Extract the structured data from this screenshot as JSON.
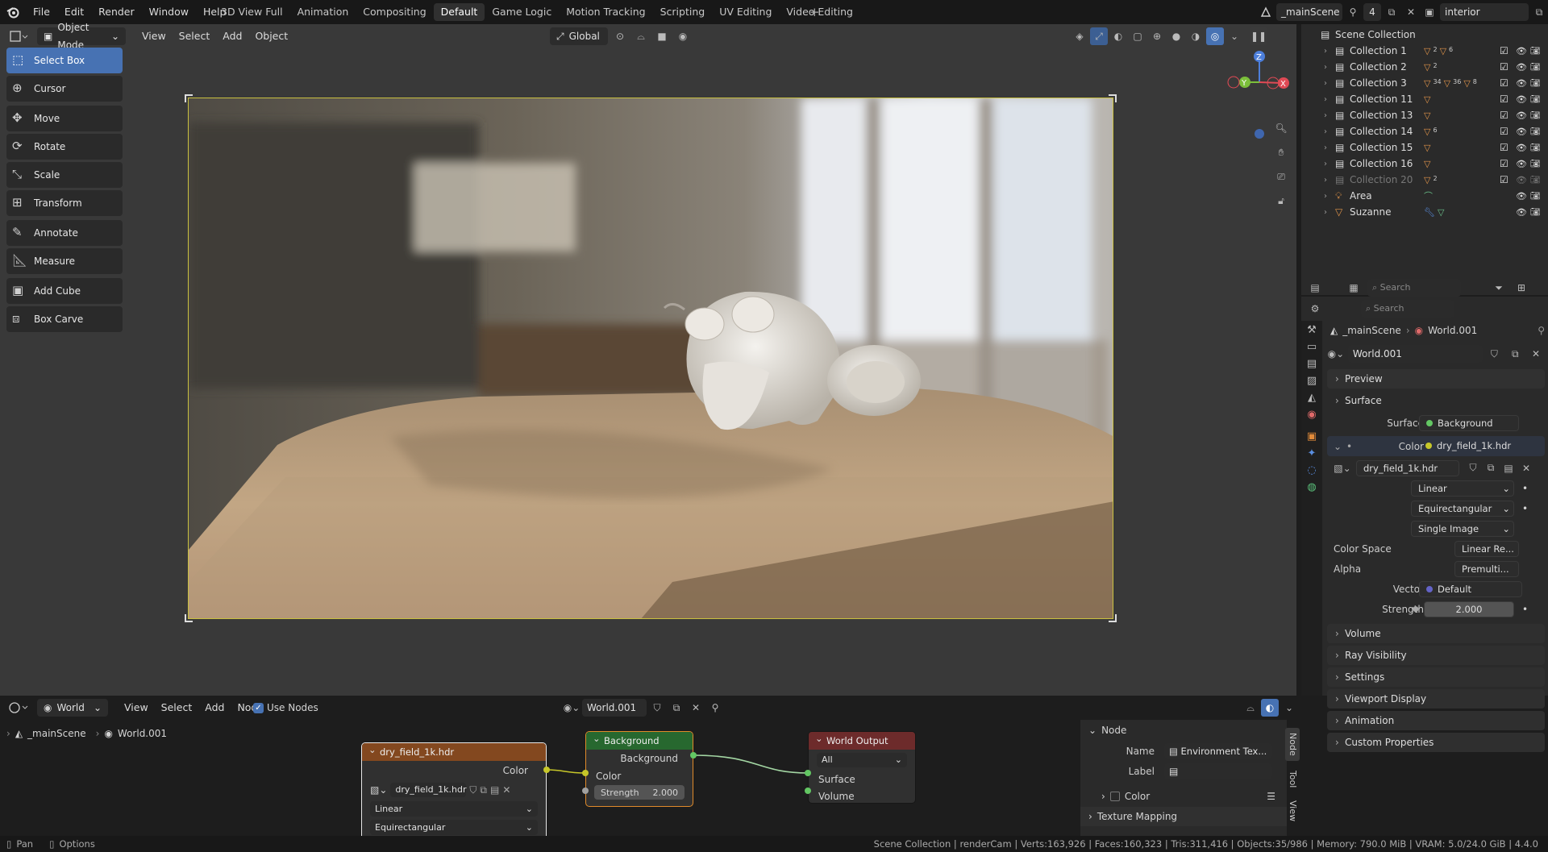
{
  "topbar": {
    "menus": [
      "File",
      "Edit",
      "Render",
      "Window",
      "Help"
    ],
    "workspaces": [
      "3D View Full",
      "Animation",
      "Compositing",
      "Default",
      "Game Logic",
      "Motion Tracking",
      "Scripting",
      "UV Editing",
      "Video Editing"
    ],
    "active_workspace": "Default",
    "scene_name": "_mainScene",
    "scene_users": "4",
    "view_layer": "interior"
  },
  "viewport": {
    "mode": "Object Mode",
    "menus": [
      "View",
      "Select",
      "Add",
      "Object"
    ],
    "transform_orientation": "Global",
    "axes": {
      "z": "Z",
      "y": "Y",
      "x": "X"
    }
  },
  "toolbar": {
    "tools": [
      {
        "label": "Select Box",
        "icon": "select-box-icon",
        "active": true
      },
      {
        "label": "Cursor",
        "icon": "cursor-icon"
      },
      {
        "label": "Move",
        "icon": "move-icon"
      },
      {
        "label": "Rotate",
        "icon": "rotate-icon"
      },
      {
        "label": "Scale",
        "icon": "scale-icon"
      },
      {
        "label": "Transform",
        "icon": "transform-icon"
      },
      {
        "label": "Annotate",
        "icon": "annotate-icon"
      },
      {
        "label": "Measure",
        "icon": "measure-icon"
      },
      {
        "label": "Add Cube",
        "icon": "add-cube-icon"
      },
      {
        "label": "Box Carve",
        "icon": "box-carve-icon"
      }
    ]
  },
  "outliner": {
    "title": "Scene Collection",
    "items": [
      {
        "label": "Collection 1",
        "badges": [
          "2",
          "6"
        ]
      },
      {
        "label": "Collection 2",
        "badges": [
          "2"
        ]
      },
      {
        "label": "Collection 3",
        "badges": [
          "34",
          "36",
          "8"
        ]
      },
      {
        "label": "Collection 11",
        "badges": []
      },
      {
        "label": "Collection 13",
        "badges": []
      },
      {
        "label": "Collection 14",
        "badges": [
          "6"
        ]
      },
      {
        "label": "Collection 15",
        "badges": []
      },
      {
        "label": "Collection 16",
        "badges": []
      },
      {
        "label": "Collection 20",
        "badges": [
          "2"
        ]
      },
      {
        "label": "Area",
        "badges": []
      },
      {
        "label": "Suzanne",
        "badges": []
      }
    ],
    "search_placeholder": "Search"
  },
  "properties": {
    "search_placeholder": "Search",
    "breadcrumb_scene": "_mainScene",
    "breadcrumb_world": "World.001",
    "world_name": "World.001",
    "panels_top": [
      "Preview",
      "Surface"
    ],
    "surface_label": "Surface",
    "surface_value": "Background",
    "color_label": "Color",
    "color_value": "dry_field_1k.hdr",
    "image_name": "dry_field_1k.hdr",
    "interpolation": "Linear",
    "projection": "Equirectangular",
    "source": "Single Image",
    "color_space_label": "Color Space",
    "color_space_value": "Linear Re...",
    "alpha_label": "Alpha",
    "alpha_value": "Premulti...",
    "vector_label": "Vector",
    "vector_value": "Default",
    "strength_label": "Strength",
    "strength_value": "2.000",
    "panels_bottom": [
      "Volume",
      "Ray Visibility",
      "Settings",
      "Viewport Display",
      "Animation",
      "Custom Properties"
    ]
  },
  "node_editor": {
    "type": "World",
    "menus": [
      "View",
      "Select",
      "Add",
      "Node"
    ],
    "use_nodes_label": "Use Nodes",
    "world_name": "World.001",
    "breadcrumb_scene": "_mainScene",
    "breadcrumb_world": "World.001",
    "env_node": {
      "title": "dry_field_1k.hdr",
      "output": "Color",
      "image": "dry_field_1k.hdr",
      "interp": "Linear",
      "proj": "Equirectangular"
    },
    "bg_node": {
      "title": "Background",
      "output": "Background",
      "input_color": "Color",
      "strength_label": "Strength",
      "strength_value": "2.000"
    },
    "out_node": {
      "title": "World Output",
      "target": "All",
      "surface": "Surface",
      "volume": "Volume"
    },
    "side_panel": {
      "section": "Node",
      "name_label": "Name",
      "name_value": "Environment Tex...",
      "label_label": "Label",
      "label_value": "",
      "color_label": "Color",
      "texture_mapping": "Texture Mapping",
      "tabs": [
        "Node",
        "Tool",
        "View"
      ]
    }
  },
  "status_bar": {
    "left": [
      "Pan",
      "Options"
    ],
    "right": "Scene Collection | renderCam | Verts:163,926 | Faces:160,323 | Tris:311,416 | Objects:35/986 | Memory: 790.0 MiB | VRAM: 5.0/24.0 GiB | 4.4.0"
  },
  "colors": {
    "accent": "#4772b3",
    "node_env_header": "#83481f",
    "node_bg_header": "#27682f",
    "node_out_header": "#6d2b2b",
    "socket_yellow": "#c7c729",
    "socket_green": "#63c763",
    "socket_grey": "#a1a1a1",
    "camera_frame": "#c9c040"
  }
}
